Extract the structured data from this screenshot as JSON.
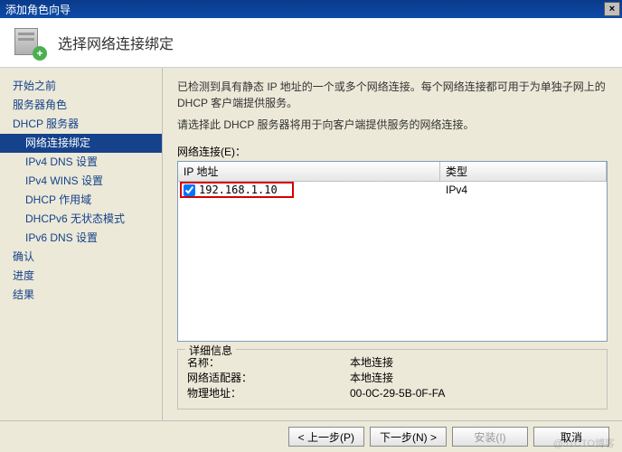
{
  "window": {
    "title": "添加角色向导",
    "close": "×"
  },
  "header": {
    "title": "选择网络连接绑定"
  },
  "sidebar": {
    "items": [
      {
        "label": "开始之前",
        "child": false,
        "active": false
      },
      {
        "label": "服务器角色",
        "child": false,
        "active": false
      },
      {
        "label": "DHCP 服务器",
        "child": false,
        "active": false
      },
      {
        "label": "网络连接绑定",
        "child": true,
        "active": true
      },
      {
        "label": "IPv4 DNS 设置",
        "child": true,
        "active": false
      },
      {
        "label": "IPv4 WINS 设置",
        "child": true,
        "active": false
      },
      {
        "label": "DHCP 作用域",
        "child": true,
        "active": false
      },
      {
        "label": "DHCPv6 无状态模式",
        "child": true,
        "active": false
      },
      {
        "label": "IPv6 DNS 设置",
        "child": true,
        "active": false
      },
      {
        "label": "确认",
        "child": false,
        "active": false
      },
      {
        "label": "进度",
        "child": false,
        "active": false
      },
      {
        "label": "结果",
        "child": false,
        "active": false
      }
    ]
  },
  "content": {
    "desc1": "已检测到具有静态 IP 地址的一个或多个网络连接。每个网络连接都可用于为单独子网上的 DHCP 客户端提供服务。",
    "desc2": "请选择此 DHCP 服务器将用于向客户端提供服务的网络连接。",
    "sectionLabel": "网络连接(E)：",
    "grid": {
      "col1": "IP 地址",
      "col2": "类型",
      "rows": [
        {
          "ip": "192.168.1.10",
          "type": "IPv4",
          "checked": true
        }
      ]
    },
    "details": {
      "title": "详细信息",
      "nameLabel": "名称：",
      "nameValue": "本地连接",
      "adapterLabel": "网络适配器：",
      "adapterValue": "本地连接",
      "macLabel": "物理地址：",
      "macValue": "00-0C-29-5B-0F-FA"
    }
  },
  "buttons": {
    "prev": "< 上一步(P)",
    "next": "下一步(N) >",
    "install": "安装(I)",
    "cancel": "取消"
  },
  "watermark": "@51CTO博客"
}
